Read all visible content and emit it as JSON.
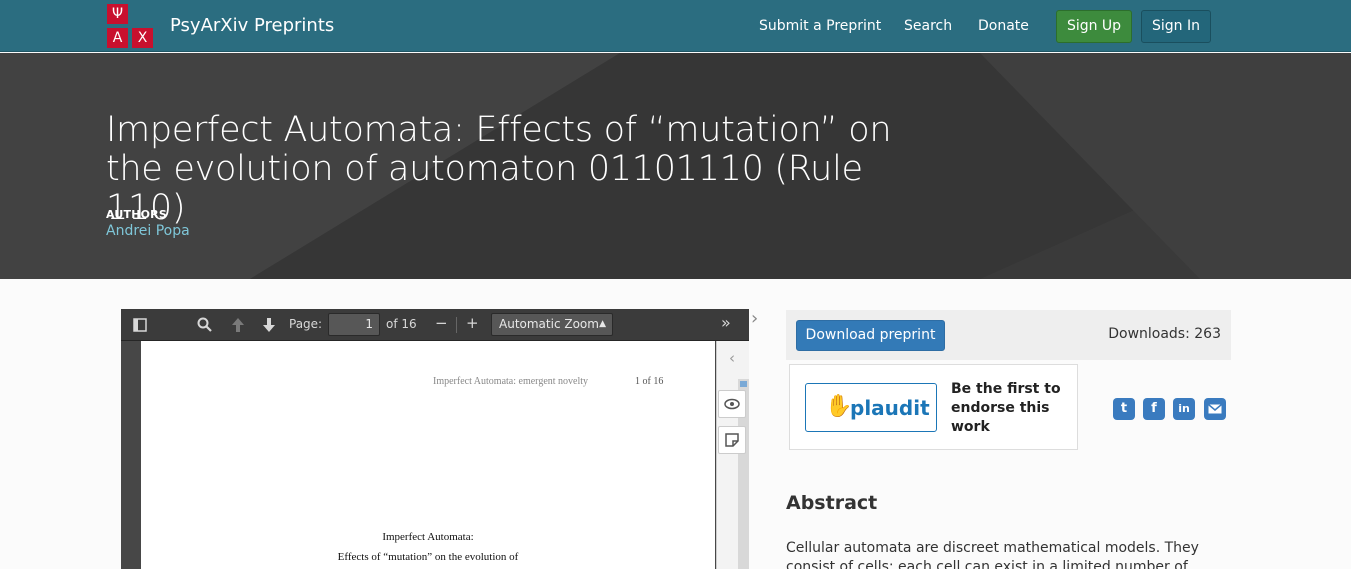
{
  "navbar": {
    "logo_letters": [
      "Ψ",
      "Α",
      "Χ"
    ],
    "brand": "PsyArXiv Preprints",
    "links": [
      "Submit a Preprint",
      "Search",
      "Donate"
    ],
    "signup_label": "Sign Up",
    "signin_label": "Sign In"
  },
  "header": {
    "title": "Imperfect Automata: Effects of “mutation” on the evolution of automaton 01101110 (Rule 110)",
    "authors_label": "AUTHORS",
    "author": "Andrei Popa"
  },
  "viewer": {
    "page_label": "Page:",
    "page_value": "1",
    "page_total": "of 16",
    "zoom": "Automatic Zoom",
    "running_head": "Imperfect Automata: emergent novelty",
    "page_number": "1 of 16",
    "doc_title_line1": "Imperfect Automata:",
    "doc_title_line2": "Effects of “mutation” on the evolution of"
  },
  "download": {
    "button": "Download preprint",
    "count": "Downloads: 263"
  },
  "plaudit": {
    "logo_text": "plaudit",
    "cta": "Be the first to endorse this work"
  },
  "share_icons": [
    "twitter-icon",
    "facebook-icon",
    "linkedin-icon",
    "email-icon"
  ],
  "abstract": {
    "heading": "Abstract",
    "text": "Cellular automata are discreet mathematical models. They consist of cells; each cell can exist in a limited number of mutually exclusive"
  },
  "colors": {
    "navbar": "#2b6d80",
    "header_band": "#3a3a3a",
    "signup": "#3d8b3d",
    "download": "#337ab7",
    "logo_red": "#c8102e"
  }
}
